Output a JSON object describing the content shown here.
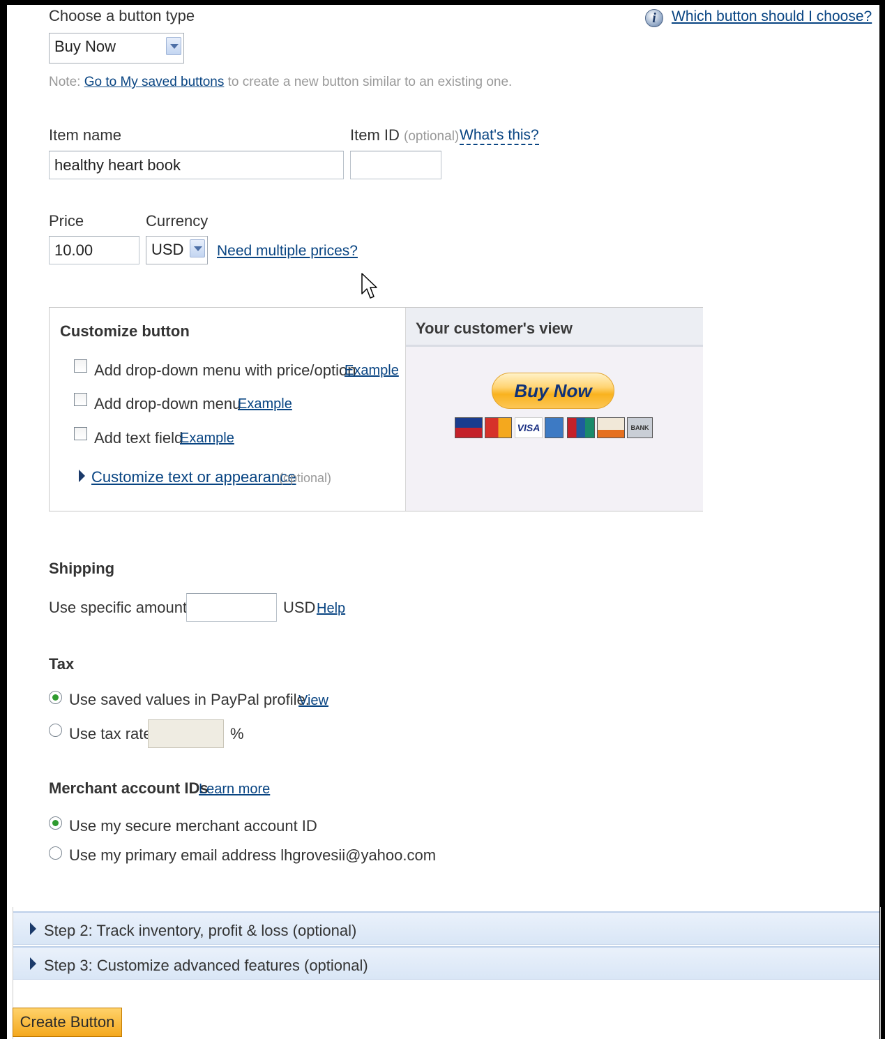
{
  "header": {
    "choose_type_label": "Choose a button type",
    "button_type_value": "Buy Now",
    "help_link": "Which button should I choose?",
    "note_prefix": "Note:",
    "note_link": "Go to My saved buttons",
    "note_suffix": "to create a new button similar to an existing one."
  },
  "item": {
    "name_label": "Item name",
    "name_value": "healthy heart book",
    "id_label": "Item ID",
    "id_optional": "(optional)",
    "id_help": "What's this?",
    "id_value": ""
  },
  "price": {
    "price_label": "Price",
    "price_value": "10.00",
    "currency_label": "Currency",
    "currency_value": "USD",
    "multiple_prices_link": "Need multiple prices?"
  },
  "customize": {
    "title": "Customize button",
    "options": [
      {
        "label": "Add drop-down menu with price/option",
        "link": "Example",
        "checked": false
      },
      {
        "label": "Add drop-down menu",
        "link": "Example",
        "checked": false
      },
      {
        "label": "Add text field",
        "link": "Example",
        "checked": false
      }
    ],
    "appearance_link": "Customize text or appearance",
    "appearance_optional": "(optional)"
  },
  "preview": {
    "title": "Your customer's view",
    "button_label": "Buy Now",
    "cards": [
      {
        "name": "Maestro",
        "color": "#c4212a"
      },
      {
        "name": "MasterCard",
        "color": "#d6322a"
      },
      {
        "name": "VISA",
        "color": "#ffffff"
      },
      {
        "name": "AMEX",
        "color": "#3d7ac4"
      },
      {
        "name": "UnionPay",
        "color": "#1f5c9e"
      },
      {
        "name": "DISCOVER",
        "color": "#f1e8d8"
      },
      {
        "name": "BANK",
        "color": "#c9ced6"
      }
    ]
  },
  "shipping": {
    "title": "Shipping",
    "amount_label": "Use specific amount:",
    "amount_value": "",
    "currency": "USD",
    "help": "Help"
  },
  "tax": {
    "title": "Tax",
    "saved_label": "Use saved values in PayPal profile.",
    "saved_link": "View",
    "rate_label": "Use tax rate",
    "rate_value": "",
    "percent": "%",
    "selected": "saved"
  },
  "merchant": {
    "title": "Merchant account IDs",
    "learn_more": "Learn more",
    "secure_label": "Use my secure merchant account ID",
    "email_label": "Use my primary email address lhgrovesii@yahoo.com",
    "selected": "secure"
  },
  "steps": {
    "step2": "Step 2: Track inventory, profit & loss (optional)",
    "step3": "Step 3: Customize advanced features (optional)"
  },
  "actions": {
    "create_button": "Create Button"
  },
  "colors": {
    "link": "#084482",
    "accent_orange": "#f4a81e",
    "radio_selected": "#2f9b2f"
  }
}
